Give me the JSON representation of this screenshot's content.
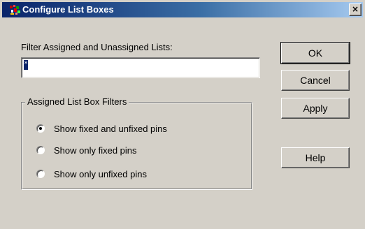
{
  "window": {
    "title": "Configure List Boxes",
    "close_glyph": "×",
    "app_icon": "pcb-app-icon"
  },
  "filter": {
    "label": "Filter Assigned and Unassigned Lists:",
    "value": "*"
  },
  "group": {
    "title": "Assigned List Box Filters",
    "options": [
      {
        "label": "Show fixed and unfixed pins",
        "checked": true
      },
      {
        "label": "Show only fixed pins",
        "checked": false
      },
      {
        "label": "Show only unfixed pins",
        "checked": false
      }
    ]
  },
  "buttons": {
    "ok": "OK",
    "cancel": "Cancel",
    "apply": "Apply",
    "help": "Help"
  }
}
